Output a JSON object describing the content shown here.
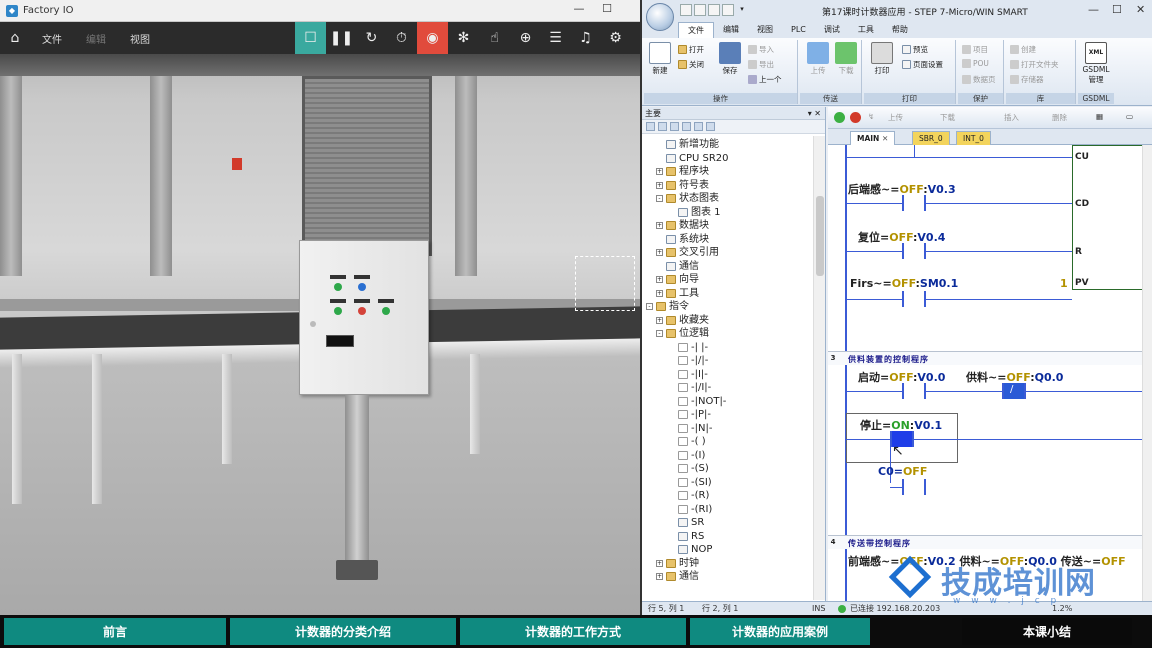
{
  "factoryio": {
    "title": "Factory IO",
    "menus": [
      "文件",
      "编辑",
      "视图"
    ],
    "colors": {
      "toolbar": "#2b2b2b",
      "active_green": "#3aa99f",
      "active_red": "#e14b3c"
    }
  },
  "step7": {
    "title": "第17课时计数器应用 - STEP 7-Micro/WIN SMART",
    "tabs": [
      "文件",
      "编辑",
      "视图",
      "PLC",
      "调试",
      "工具",
      "帮助"
    ],
    "ribbon": {
      "new": "新建",
      "open": "打开",
      "close": "关闭",
      "save": "保存",
      "import": "导入",
      "export": "导出",
      "previous": "上一个",
      "upload": "上传",
      "download": "下载",
      "print": "打印",
      "preview": "预览",
      "page_setup": "页面设置",
      "project": "项目",
      "pou": "POU",
      "data_page": "数据页",
      "create": "创建",
      "open_lib_folder": "打开文件夹",
      "memory": "存储器",
      "gsdml": "GSDML",
      "gsdml_manage": "管理",
      "xml_tag": "XML",
      "groups": [
        "操作",
        "传送",
        "打印",
        "保护",
        "库",
        "GSDML"
      ]
    },
    "left_panel_header": "主要",
    "tree": [
      "新增功能",
      "CPU SR20",
      "程序块",
      "符号表",
      "状态图表",
      "图表 1",
      "数据块",
      "系统块",
      "交叉引用",
      "通信",
      "向导",
      "工具",
      "指令",
      "收藏夹",
      "位逻辑",
      "-| |-",
      "-|/|-",
      "-|I|-",
      "-|/I|-",
      "-|NOT|-",
      "-|P|-",
      "-|N|-",
      "-( )",
      "-(I)",
      "-(S)",
      "-(SI)",
      "-(R)",
      "-(RI)",
      "SR",
      "RS",
      "NOP",
      "时钟",
      "通信"
    ],
    "editor_toolbar": {
      "upload": "上传",
      "download": "下载",
      "insert": "插入",
      "delete": "删除"
    },
    "editor_tabs": [
      "MAIN",
      "SBR_0",
      "INT_0"
    ],
    "ladder": {
      "counter_pins": {
        "cu": "CU",
        "cd": "CD",
        "r": "R",
        "pv": "PV",
        "pv_value": "1"
      },
      "rung2": [
        {
          "name": "后端感~=",
          "state": "OFF",
          "addr": "V0.3"
        },
        {
          "name": "复位=",
          "state": "OFF",
          "addr": "V0.4"
        },
        {
          "name": "Firs~=",
          "state": "OFF",
          "addr": "SM0.1"
        }
      ],
      "net3_num": "3",
      "net3_title": "供料装置的控制程序",
      "rung3": [
        {
          "name": "启动=",
          "state": "OFF",
          "addr": "V0.0"
        },
        {
          "name": "供料~=",
          "state": "OFF",
          "addr": "Q0.0"
        },
        {
          "name": "停止=",
          "state": "ON",
          "addr": "V0.1"
        },
        {
          "name": "C0=",
          "state": "OFF",
          "addr": ""
        }
      ],
      "net4_num": "4",
      "net4_title": "传送带控制程序",
      "rung4": {
        "name1": "前端感~=",
        "state1": "OFF",
        "addr1": "V0.2",
        "name2": "供料~=",
        "state2": "OFF",
        "addr2": "Q0.0",
        "name3": "传送~=",
        "state3": "OFF"
      }
    },
    "status": {
      "pos1": "行 5, 列 1",
      "pos2": "行 2, 列 1",
      "ins": "INS",
      "connection": "已连接 192.168.20.203",
      "zoom": "1.2%"
    }
  },
  "watermark": {
    "text": "技成培训网",
    "url": "w w w . j c p"
  },
  "bottom_nav": [
    "前言",
    "计数器的分类介绍",
    "计数器的工作方式",
    "计数器的应用案例",
    "本课小结"
  ]
}
